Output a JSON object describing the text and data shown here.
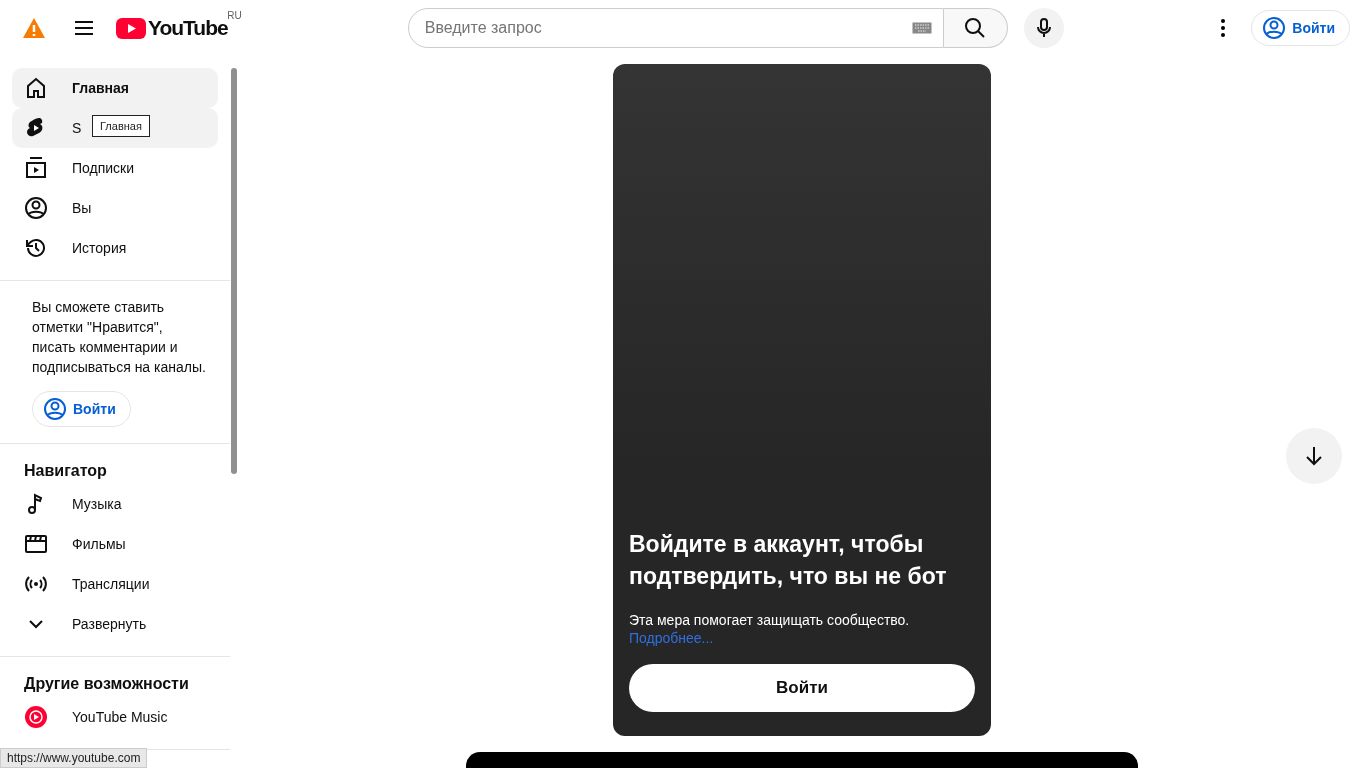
{
  "header": {
    "logo_text": "YouTube",
    "region": "RU",
    "search": {
      "placeholder": "Введите запрос"
    },
    "sign_in": "Войти"
  },
  "sidebar": {
    "main_items": [
      {
        "kind": "home",
        "label": "Главная",
        "selected": true,
        "hovered": false
      },
      {
        "kind": "shorts",
        "label": "S",
        "selected": false,
        "hovered": true
      },
      {
        "kind": "subscriptions",
        "label": "Подписки",
        "selected": false,
        "hovered": false
      },
      {
        "kind": "you",
        "label": "Вы",
        "selected": false,
        "hovered": false
      },
      {
        "kind": "history",
        "label": "История",
        "selected": false,
        "hovered": false
      }
    ],
    "tooltip": "Главная",
    "promo": {
      "text": "Вы сможете ставить отметки \"Нравится\", писать комментарии и подписываться на каналы.",
      "button": "Войти"
    },
    "navigator": {
      "title": "Навигатор",
      "items": [
        {
          "kind": "music",
          "label": "Музыка"
        },
        {
          "kind": "movies",
          "label": "Фильмы"
        },
        {
          "kind": "live",
          "label": "Трансляции"
        },
        {
          "kind": "expand",
          "label": "Развернуть"
        }
      ]
    },
    "more": {
      "title": "Другие возможности",
      "items": [
        {
          "kind": "ytmusic",
          "label": "YouTube Music"
        }
      ]
    }
  },
  "card": {
    "title": "Войдите в аккаунт, чтобы подтвердить, что вы не бот",
    "text": "Эта мера помогает защищать сообщество.",
    "link": "Подробнее...",
    "button": "Войти"
  },
  "status_bar": "https://www.youtube.com"
}
